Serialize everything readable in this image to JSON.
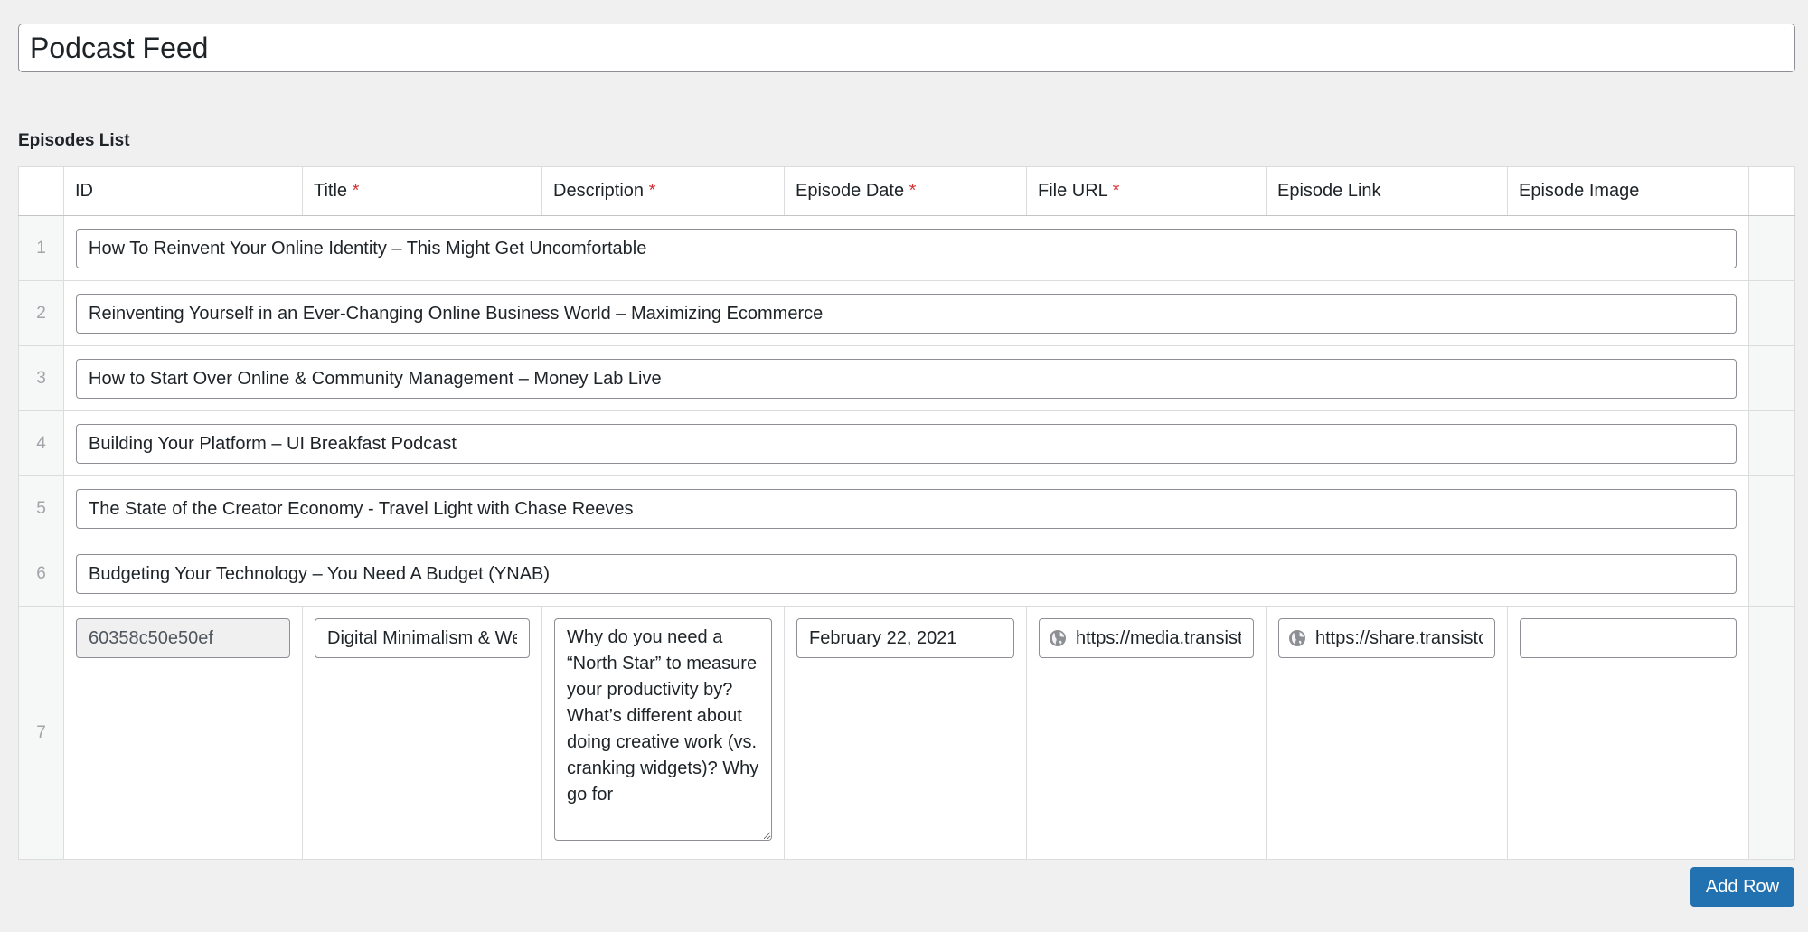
{
  "post_title": "Podcast Feed",
  "section_label": "Episodes List",
  "columns": [
    {
      "label": "ID",
      "required": false
    },
    {
      "label": "Title",
      "required": true
    },
    {
      "label": "Description",
      "required": true
    },
    {
      "label": "Episode Date",
      "required": true
    },
    {
      "label": "File URL",
      "required": true
    },
    {
      "label": "Episode Link",
      "required": false
    },
    {
      "label": "Episode Image",
      "required": false
    }
  ],
  "required_mark": "*",
  "rows": [
    {
      "num": "1",
      "summary": "How To Reinvent Your Online Identity – This Might Get Uncomfortable"
    },
    {
      "num": "2",
      "summary": "Reinventing Yourself in an Ever-Changing Online Business World – Maximizing Ecommerce"
    },
    {
      "num": "3",
      "summary": "How to Start Over Online & Community Management – Money Lab Live"
    },
    {
      "num": "4",
      "summary": "Building Your Platform – UI Breakfast Podcast"
    },
    {
      "num": "5",
      "summary": "The State of the Creator Economy - Travel Light with Chase Reeves"
    },
    {
      "num": "6",
      "summary": "Budgeting Your Technology – You Need A Budget (YNAB)"
    }
  ],
  "expanded_row": {
    "num": "7",
    "id": "60358c50e50ef",
    "title": "Digital Minimalism & Wellbeing",
    "description": "Why do you need a “North Star” to measure your productivity by? What’s different about doing creative work (vs. cranking widgets)? Why go for",
    "episode_date": "February 22, 2021",
    "file_url": "https://media.transistor.fm",
    "episode_link": "https://share.transistor.fm",
    "episode_image": ""
  },
  "add_row_label": "Add Row",
  "colors": {
    "accent": "#2271b1",
    "required": "#d63638"
  }
}
